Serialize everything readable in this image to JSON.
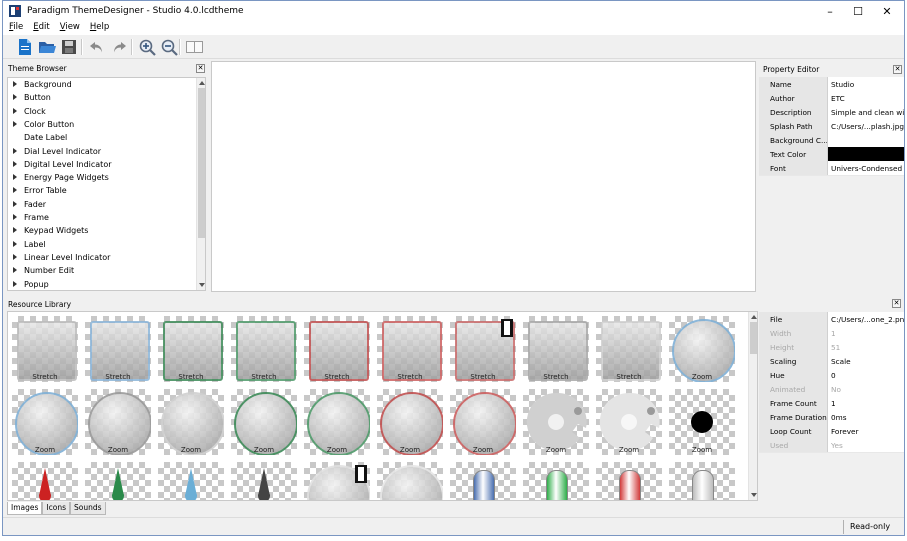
{
  "window": {
    "title": "Paradigm ThemeDesigner - Studio 4.0.lcdtheme",
    "controls": {
      "minimize": "–",
      "maximize": "☐",
      "close": "✕"
    }
  },
  "menu": [
    {
      "label": "File",
      "mnemonic": "F",
      "rest": "ile"
    },
    {
      "label": "Edit",
      "mnemonic": "E",
      "rest": "dit"
    },
    {
      "label": "View",
      "mnemonic": "V",
      "rest": "iew"
    },
    {
      "label": "Help",
      "mnemonic": "H",
      "rest": "elp"
    }
  ],
  "toolbar": {
    "icons": [
      "new-document-icon",
      "open-folder-icon",
      "save-icon",
      "undo-icon",
      "redo-icon",
      "zoom-in-icon",
      "zoom-out-icon",
      "split-view-icon"
    ],
    "accent": "#1a73c9"
  },
  "theme_browser": {
    "title": "Theme Browser",
    "items": [
      {
        "label": "Background",
        "expandable": true
      },
      {
        "label": "Button",
        "expandable": true
      },
      {
        "label": "Clock",
        "expandable": true
      },
      {
        "label": "Color Button",
        "expandable": true
      },
      {
        "label": "Date Label",
        "expandable": false
      },
      {
        "label": "Dial Level Indicator",
        "expandable": true
      },
      {
        "label": "Digital Level Indicator",
        "expandable": true
      },
      {
        "label": "Energy Page Widgets",
        "expandable": true
      },
      {
        "label": "Error Table",
        "expandable": true
      },
      {
        "label": "Fader",
        "expandable": true
      },
      {
        "label": "Frame",
        "expandable": true
      },
      {
        "label": "Keypad Widgets",
        "expandable": true
      },
      {
        "label": "Label",
        "expandable": true
      },
      {
        "label": "Linear Level Indicator",
        "expandable": true
      },
      {
        "label": "Number Edit",
        "expandable": true
      },
      {
        "label": "Popup",
        "expandable": true
      }
    ]
  },
  "property_editor": {
    "title": "Property Editor",
    "rows": [
      {
        "name": "Name",
        "value": "Studio",
        "disabled": false
      },
      {
        "name": "Author",
        "value": "ETC",
        "disabled": false
      },
      {
        "name": "Description",
        "value": "Simple and clean wit...",
        "disabled": false
      },
      {
        "name": "Splash Path",
        "value": "C:/Users/...plash.jpg",
        "disabled": false
      },
      {
        "name": "Background C...",
        "value": "",
        "disabled": false
      },
      {
        "name": "Text Color",
        "value": "",
        "swatch": "#000000",
        "disabled": false
      },
      {
        "name": "Font",
        "value": "Univers-Condensed",
        "disabled": false
      }
    ]
  },
  "resource_library": {
    "title": "Resource Library",
    "tabs": [
      "Images",
      "Icons",
      "Sounds"
    ],
    "active_tab": "Images",
    "rows": [
      [
        {
          "shape": "square",
          "border": "#bcbcbc",
          "caption": "Stretch"
        },
        {
          "shape": "square",
          "border": "#8ab4d8",
          "caption": "Stretch"
        },
        {
          "shape": "square",
          "border": "#3d8a58",
          "caption": "Stretch"
        },
        {
          "shape": "square",
          "border": "#4f9a6a",
          "caption": "Stretch"
        },
        {
          "shape": "square",
          "border": "#c05050",
          "caption": "Stretch"
        },
        {
          "shape": "square",
          "border": "#cc6060",
          "caption": "Stretch"
        },
        {
          "shape": "square",
          "border": "#c86a6a",
          "caption": "Stretch",
          "film": true
        },
        {
          "shape": "square",
          "border": "#a8a8a8",
          "caption": "Stretch"
        },
        {
          "shape": "square",
          "border": "#cfcfcf",
          "caption": "Stretch"
        },
        {
          "shape": "circle",
          "border": "#7fb0d6",
          "caption": "Zoom"
        }
      ],
      [
        {
          "shape": "circle",
          "border": "#7fb0d6",
          "caption": "Zoom"
        },
        {
          "shape": "circle",
          "border": "#9a9a9a",
          "caption": "Zoom"
        },
        {
          "shape": "circle",
          "border": "#d0d0d0",
          "caption": "Zoom"
        },
        {
          "shape": "circle",
          "border": "#3d8a58",
          "caption": "Zoom"
        },
        {
          "shape": "circle",
          "border": "#4f9a6a",
          "caption": "Zoom"
        },
        {
          "shape": "circle",
          "border": "#c05050",
          "caption": "Zoom"
        },
        {
          "shape": "circle",
          "border": "#cc6060",
          "caption": "Zoom"
        },
        {
          "shape": "gear",
          "border": "#d0d0d0",
          "caption": "Zoom"
        },
        {
          "shape": "gear",
          "border": "#e4e4e4",
          "caption": "Zoom"
        },
        {
          "shape": "dot",
          "border": "#000000",
          "caption": "Zoom"
        }
      ],
      [
        {
          "shape": "needle",
          "border": "#cc2222",
          "caption": ""
        },
        {
          "shape": "needle",
          "border": "#2a8a4a",
          "caption": ""
        },
        {
          "shape": "needle",
          "border": "#6aaed6",
          "caption": ""
        },
        {
          "shape": "needle",
          "border": "#444444",
          "caption": ""
        },
        {
          "shape": "circle",
          "border": "#e0e0e0",
          "caption": "",
          "film": true
        },
        {
          "shape": "circle",
          "border": "#e6e6e6",
          "caption": ""
        },
        {
          "shape": "pill",
          "border": "#4a6fb0",
          "caption": ""
        },
        {
          "shape": "pill",
          "border": "#2fae4a",
          "caption": ""
        },
        {
          "shape": "pill",
          "border": "#d23b3b",
          "caption": ""
        },
        {
          "shape": "pill",
          "border": "#bdbdbd",
          "caption": ""
        }
      ]
    ]
  },
  "resource_properties": {
    "rows": [
      {
        "name": "File",
        "value": "C:/Users/...one_2.png",
        "disabled": false
      },
      {
        "name": "Width",
        "value": "1",
        "disabled": true
      },
      {
        "name": "Height",
        "value": "51",
        "disabled": true
      },
      {
        "name": "Scaling",
        "value": "Scale",
        "disabled": false
      },
      {
        "name": "Hue",
        "value": "0",
        "disabled": false
      },
      {
        "name": "Animated",
        "value": "No",
        "disabled": true
      },
      {
        "name": "Frame Count",
        "value": "1",
        "disabled": false
      },
      {
        "name": "Frame Duration",
        "value": "0ms",
        "disabled": false
      },
      {
        "name": "Loop Count",
        "value": "Forever",
        "disabled": false
      },
      {
        "name": "Used",
        "value": "Yes",
        "disabled": true
      }
    ]
  },
  "status": {
    "mode": "Read-only"
  }
}
